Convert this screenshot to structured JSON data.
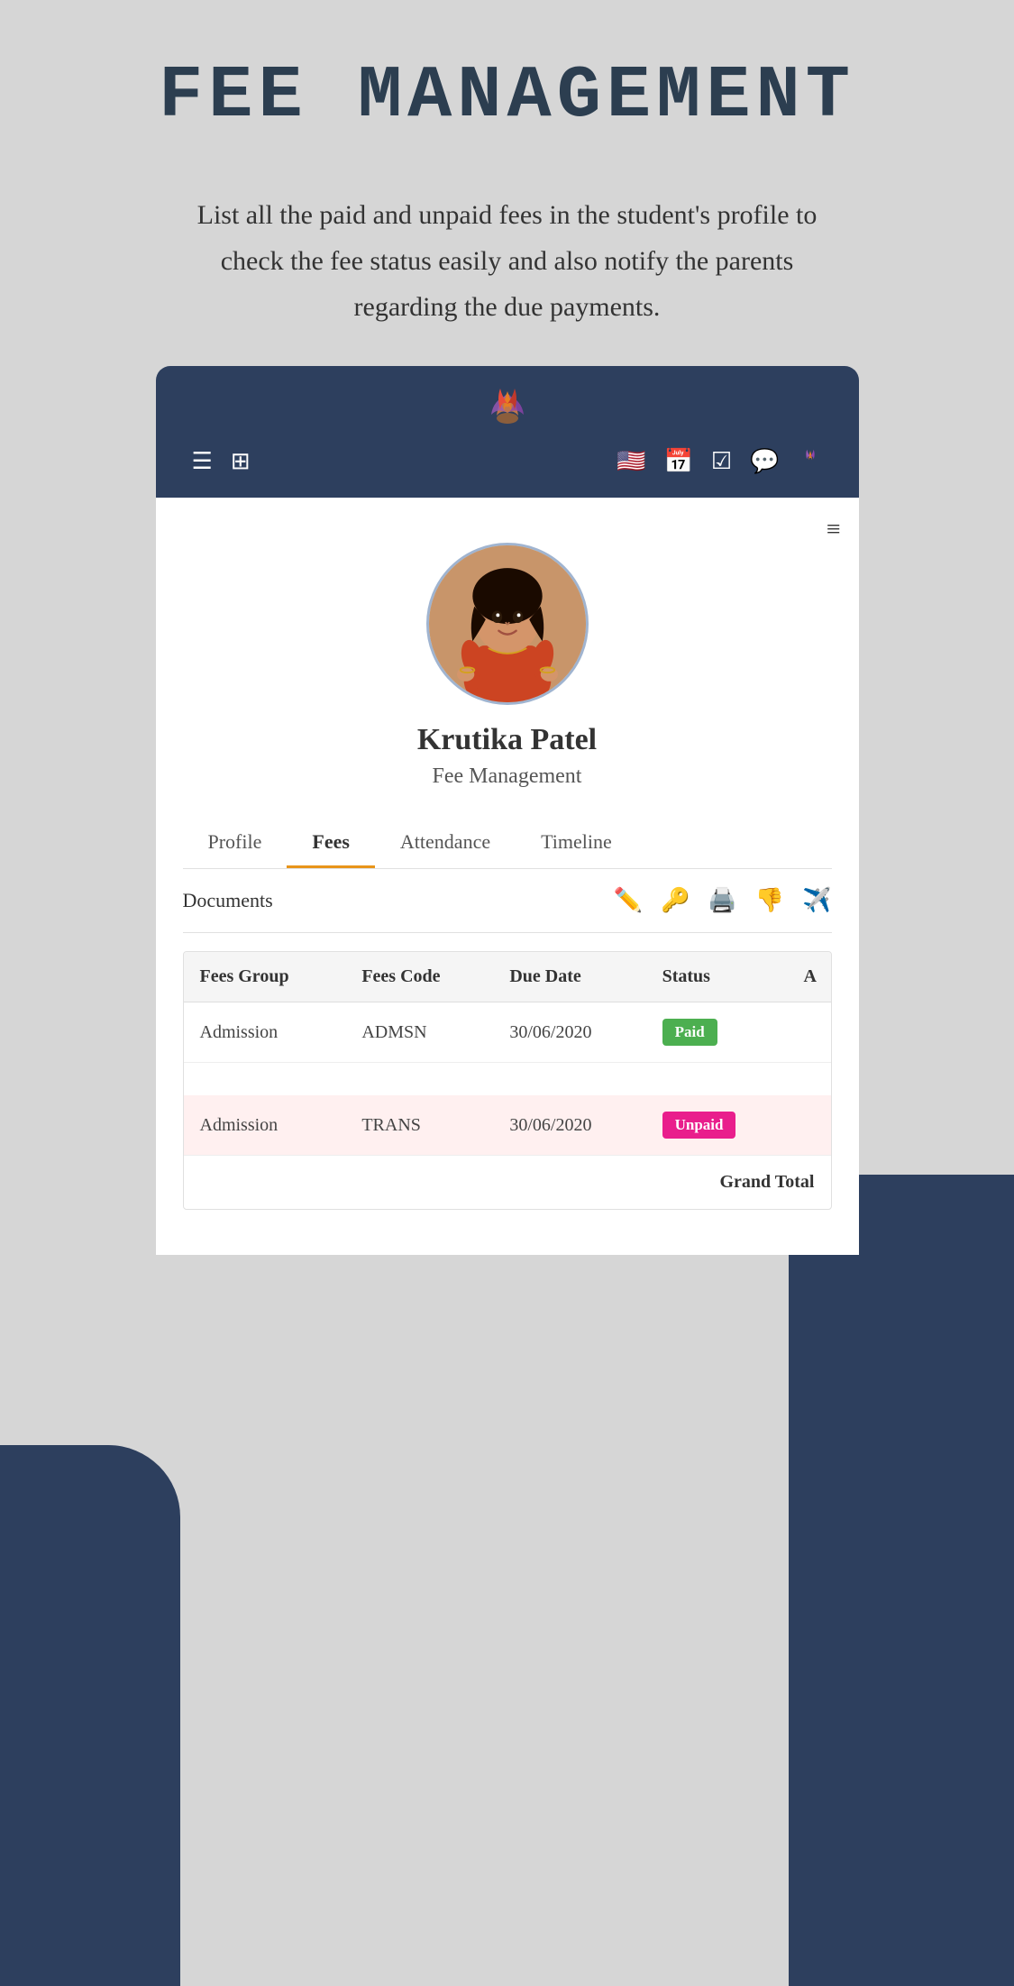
{
  "page": {
    "title": "FEE MANAGEMENT",
    "description": "List all the paid and unpaid fees in the student's profile to check the fee status easily and also notify the parents regarding the due payments."
  },
  "navbar": {
    "logo_emoji": "🌷",
    "hamburger": "☰",
    "grid": "⊞",
    "flag": "🇺🇸",
    "calendar": "📅",
    "check": "☑",
    "whatsapp": "💬",
    "lotus": "🌷"
  },
  "profile": {
    "name": "Krutika Patel",
    "subtitle": "Fee Management",
    "menu_dots": "≡"
  },
  "tabs": [
    {
      "id": "profile",
      "label": "Profile",
      "active": false
    },
    {
      "id": "fees",
      "label": "Fees",
      "active": true
    },
    {
      "id": "attendance",
      "label": "Attendance",
      "active": false
    },
    {
      "id": "timeline",
      "label": "Timeline",
      "active": false
    }
  ],
  "documents": {
    "label": "Documents"
  },
  "table": {
    "headers": [
      "Fees Group",
      "Fees Code",
      "Due Date",
      "Status",
      "A"
    ],
    "rows": [
      {
        "fees_group": "Admission",
        "fees_code": "ADMSN",
        "due_date": "30/06/2020",
        "status": "Paid",
        "status_type": "paid"
      },
      {
        "fees_group": "Admission",
        "fees_code": "TRANS",
        "due_date": "30/06/2020",
        "status": "Unpaid",
        "status_type": "unpaid"
      }
    ],
    "grand_total_label": "Grand Total"
  }
}
